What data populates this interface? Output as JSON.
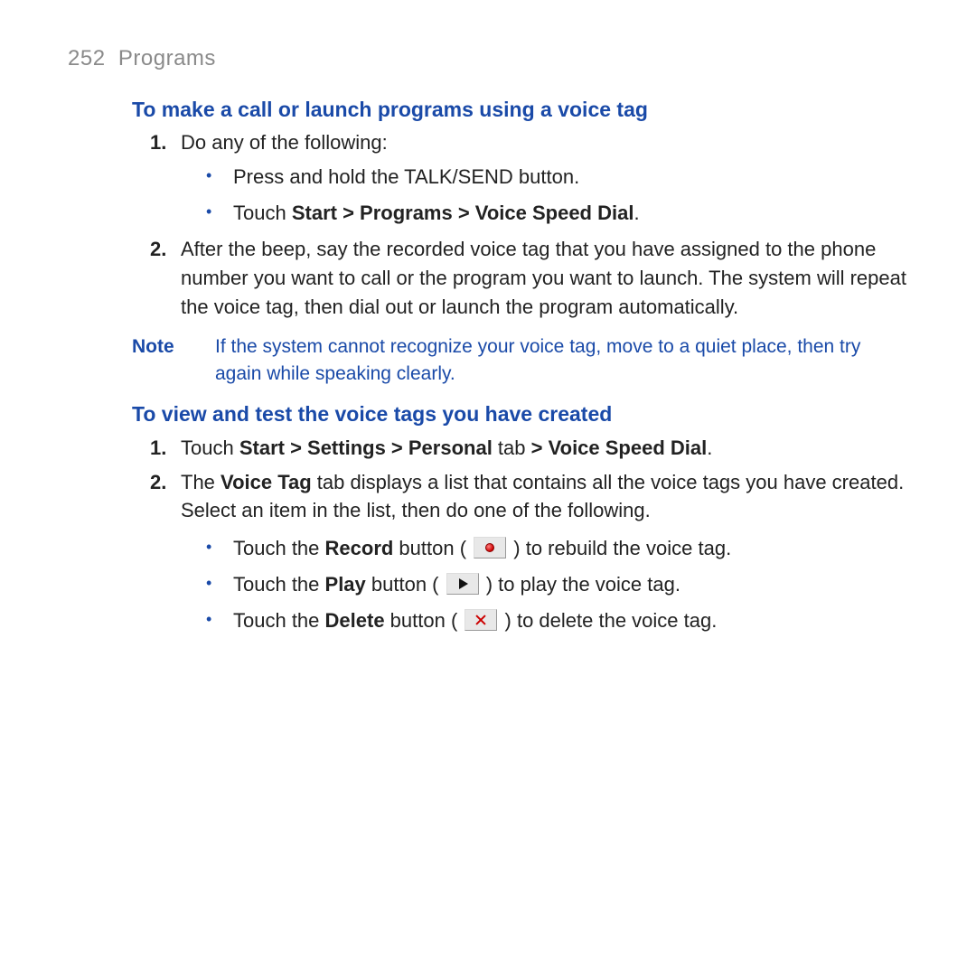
{
  "header": {
    "page_number": "252",
    "chapter": "Programs"
  },
  "section1": {
    "title": "To make a call or launch programs using a voice tag",
    "step1_num": "1.",
    "step1_text": "Do any of the following:",
    "step1_b1": "Press and hold the TALK/SEND button.",
    "step1_b2_prefix": "Touch ",
    "step1_b2_bold": "Start > Programs > Voice Speed Dial",
    "step1_b2_suffix": ".",
    "step2_num": "2.",
    "step2_text": "After the beep, say the recorded voice tag that you have assigned to the phone number you want to call or the program you want to launch. The system will repeat the voice tag, then dial out or launch the program automatically."
  },
  "note": {
    "label": "Note",
    "text": "If the system cannot recognize your voice tag, move to a quiet place, then try again while speaking clearly."
  },
  "section2": {
    "title": "To view and test the voice tags you have created",
    "step1_num": "1.",
    "step1_prefix": "Touch ",
    "step1_bold1": "Start > Settings > Personal",
    "step1_mid": " tab ",
    "step1_bold2": "> Voice Speed Dial",
    "step1_suffix": ".",
    "step2_num": "2.",
    "step2_a": "The ",
    "step2_b": "Voice Tag",
    "step2_c": " tab displays a list that contains all the voice tags you have created. Select an item in the list, then do one of the following.",
    "b1_a": "Touch the ",
    "b1_b": "Record",
    "b1_c": " button ( ",
    "b1_d": " ) to rebuild the voice tag.",
    "b2_a": "Touch the ",
    "b2_b": "Play",
    "b2_c": " button ( ",
    "b2_d": " ) to play the voice tag.",
    "b3_a": "Touch the ",
    "b3_b": "Delete",
    "b3_c": " button ( ",
    "b3_d": " ) to delete the voice tag."
  }
}
